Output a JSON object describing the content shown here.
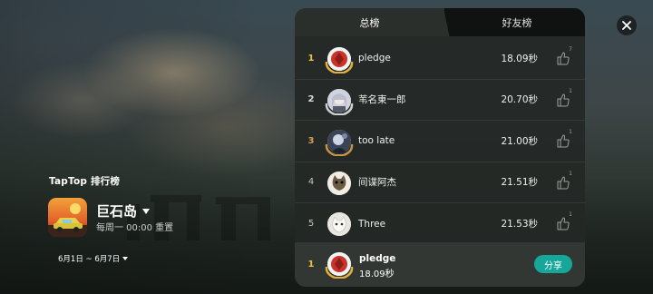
{
  "brand": "TapTop 排行榜",
  "game": {
    "title": "巨石岛",
    "reset": "每周一 00:00 重置"
  },
  "date_range": "6月1日 ~ 6月7日",
  "tabs": [
    {
      "label": "总榜",
      "active": true
    },
    {
      "label": "好友榜",
      "active": false
    }
  ],
  "rows": [
    {
      "rank": "1",
      "name": "pledge",
      "time": "18.09秒",
      "likes": "7",
      "avatar": "red-emblem-avatar"
    },
    {
      "rank": "2",
      "name": "苇名東一郎",
      "time": "20.70秒",
      "likes": "1",
      "avatar": "anime-girl-avatar"
    },
    {
      "rank": "3",
      "name": "too late",
      "time": "21.00秒",
      "likes": "1",
      "avatar": "character-avatar"
    },
    {
      "rank": "4",
      "name": "间谍阿杰",
      "time": "21.51秒",
      "likes": "1",
      "avatar": "cat-avatar"
    },
    {
      "rank": "5",
      "name": "Three",
      "time": "21.53秒",
      "likes": "1",
      "avatar": "white-cat-avatar"
    }
  ],
  "me": {
    "rank": "1",
    "name": "pledge",
    "time": "18.09秒",
    "share_label": "分享"
  },
  "colors": {
    "accent": "#16a79a",
    "gold": "#f0c040",
    "panel": "#242826"
  }
}
